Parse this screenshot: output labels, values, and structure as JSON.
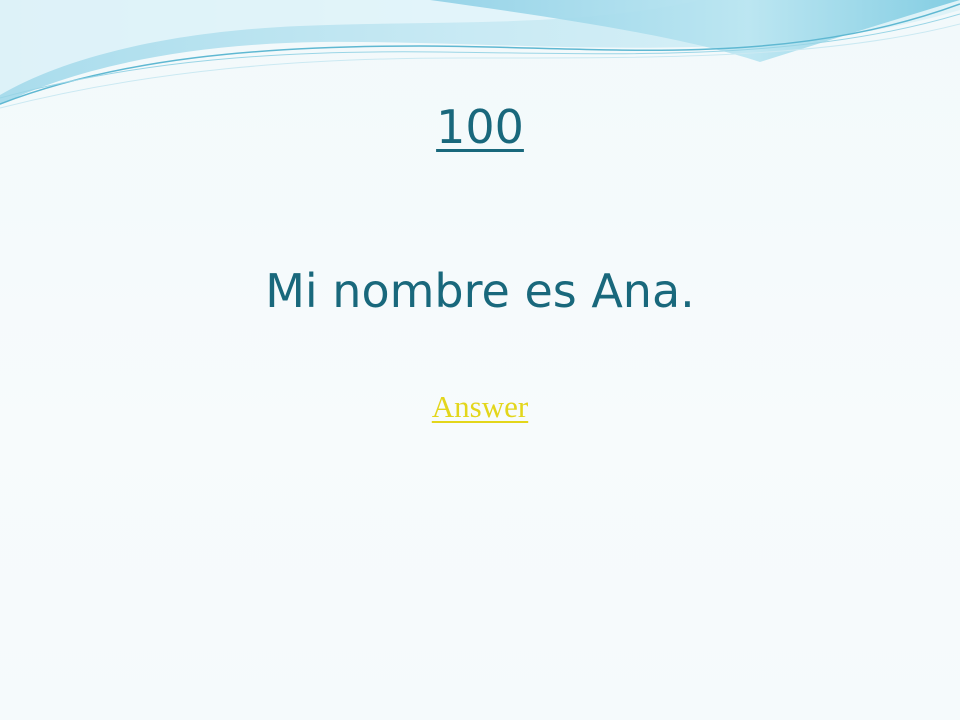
{
  "slide": {
    "title_link": "100",
    "question": "Mi nombre es Ana.",
    "answer_link": "Answer"
  },
  "colors": {
    "text": "#19687c",
    "link": "#e3d61b",
    "background": "#f5fbfd",
    "wave_light": "#cfeef6",
    "wave_accent": "#6cc6de"
  }
}
